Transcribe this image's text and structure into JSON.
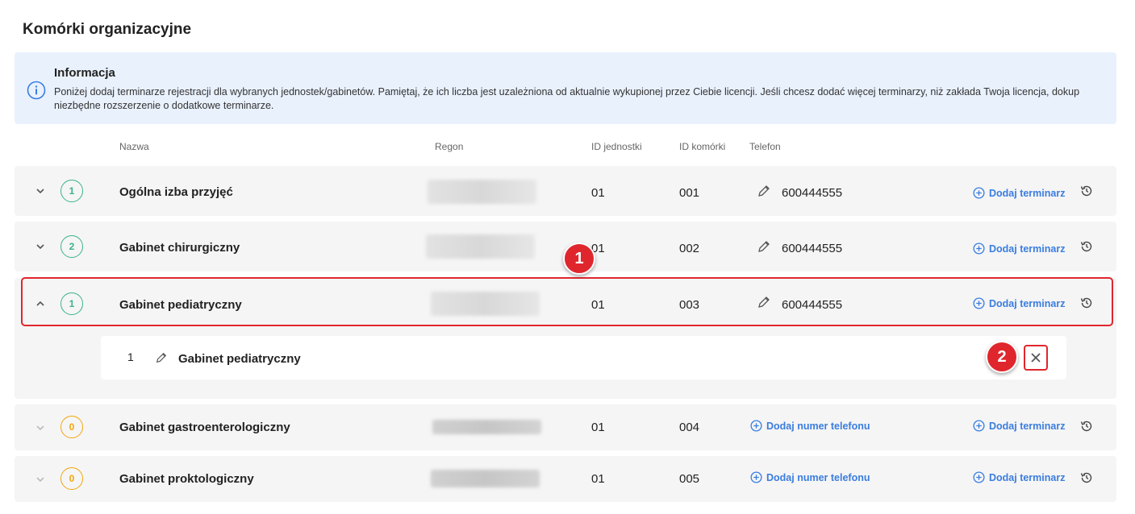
{
  "page": {
    "title": "Komórki organizacyjne"
  },
  "info": {
    "title": "Informacja",
    "text": "Poniżej dodaj terminarze rejestracji dla wybranych jednostek/gabinetów. Pamiętaj, że ich liczba jest uzależniona od aktualnie wykupionej przez Ciebie licencji. Jeśli chcesz dodać więcej terminarzy, niż zakłada Twoja licencja, dokup niezbędne rozszerzenie o dodatkowe terminarze."
  },
  "columns": {
    "name": "Nazwa",
    "regon": "Regon",
    "unit_id": "ID jednostki",
    "cell_id": "ID komórki",
    "phone": "Telefon"
  },
  "actions": {
    "add_schedule": "Dodaj terminarz",
    "add_phone": "Dodaj numer telefonu"
  },
  "rows": [
    {
      "count": "1",
      "name": "Ogólna izba przyjęć",
      "unit_id": "01",
      "cell_id": "001",
      "phone": "600444555"
    },
    {
      "count": "2",
      "name": "Gabinet chirurgiczny",
      "unit_id": "01",
      "cell_id": "002",
      "phone": "600444555"
    },
    {
      "count": "1",
      "name": "Gabinet pediatryczny",
      "unit_id": "01",
      "cell_id": "003",
      "phone": "600444555",
      "schedules": [
        {
          "number": "1",
          "name": "Gabinet pediatryczny"
        }
      ]
    },
    {
      "count": "0",
      "name": "Gabinet gastroenterologiczny",
      "unit_id": "01",
      "cell_id": "004",
      "phone": ""
    },
    {
      "count": "0",
      "name": "Gabinet proktologiczny",
      "unit_id": "01",
      "cell_id": "005",
      "phone": ""
    }
  ],
  "markers": [
    "1",
    "2"
  ],
  "colors": {
    "accent": "#3a7de0",
    "green": "#3bb38a",
    "orange": "#f2a60c",
    "marker": "#e0262d"
  }
}
